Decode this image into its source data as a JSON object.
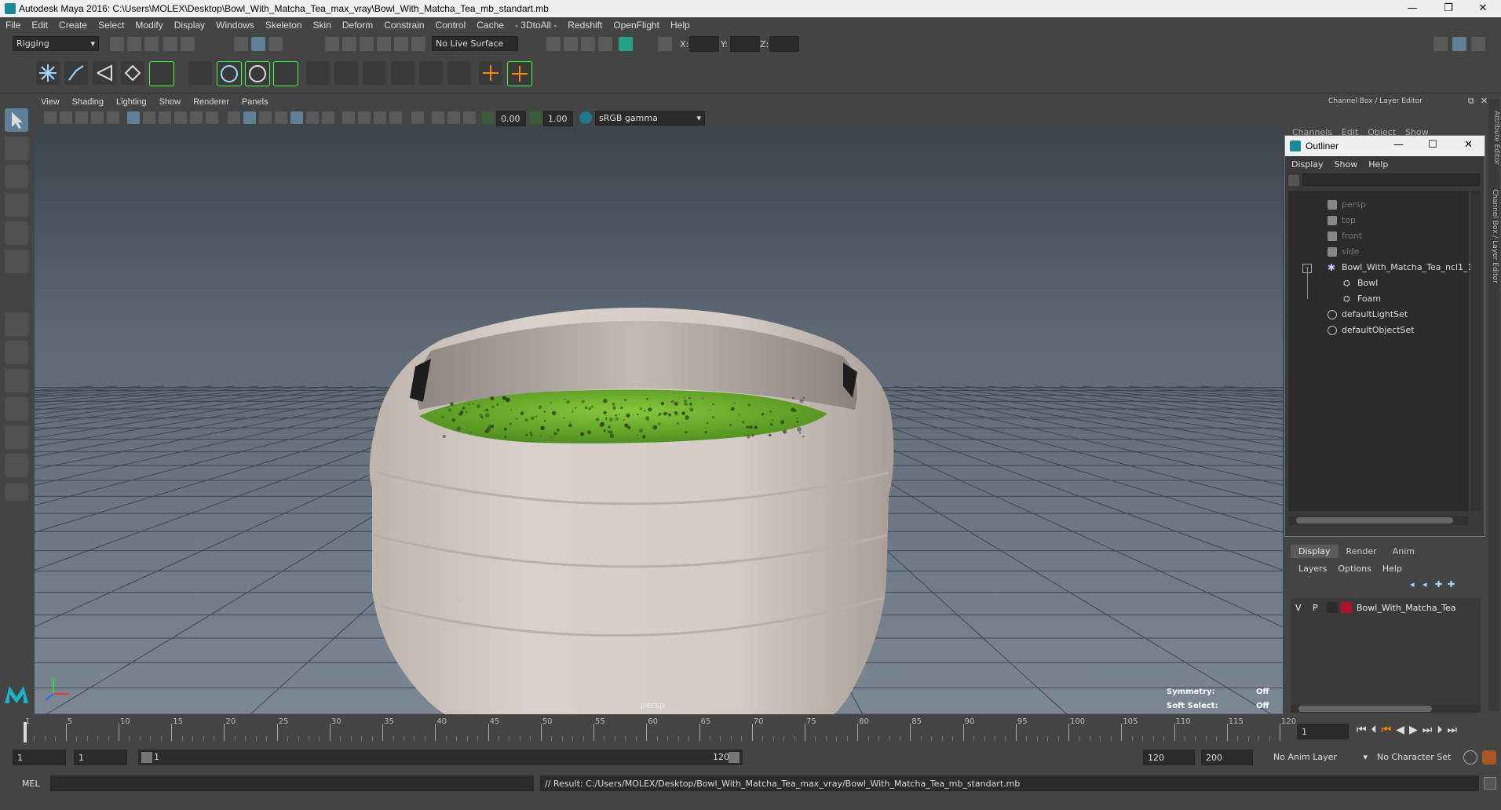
{
  "window": {
    "title": "Autodesk Maya 2016: C:\\Users\\MOLEX\\Desktop\\Bowl_With_Matcha_Tea_max_vray\\Bowl_With_Matcha_Tea_mb_standart.mb",
    "minimize": "—",
    "restore": "❐",
    "close": "✕"
  },
  "menubar": [
    "File",
    "Edit",
    "Create",
    "Select",
    "Modify",
    "Display",
    "Windows",
    "Skeleton",
    "Skin",
    "Deform",
    "Constrain",
    "Control",
    "Cache",
    "- 3DtoAll -",
    "Redshift",
    "OpenFlight",
    "Help"
  ],
  "statusline": {
    "menuset": "Rigging",
    "live_surface": "No Live Surface",
    "x_label": "X:",
    "y_label": "Y:",
    "z_label": "Z:"
  },
  "panel_menu": [
    "View",
    "Shading",
    "Lighting",
    "Show",
    "Renderer",
    "Panels"
  ],
  "panel_toolbar": {
    "exposure": "0.00",
    "gamma": "1.00",
    "colorspace": "sRGB gamma"
  },
  "viewport": {
    "camera": "persp",
    "symmetry_label": "Symmetry:",
    "symmetry_value": "Off",
    "soft_label": "Soft Select:",
    "soft_value": "Off",
    "colors": {
      "bowl": "#cfc7c0",
      "matcha": "#6bb22c"
    }
  },
  "channel_box": {
    "title": "Channel Box / Layer Editor",
    "menu": [
      "Channels",
      "Edit",
      "Object",
      "Show"
    ],
    "side_tab_1": "Attribute Editor",
    "side_tab_2": "Channel Box / Layer Editor"
  },
  "outliner": {
    "title": "Outliner",
    "menu": [
      "Display",
      "Show",
      "Help"
    ],
    "items": [
      {
        "label": "persp",
        "indent": 0,
        "dim": true,
        "icon": "camera-icon"
      },
      {
        "label": "top",
        "indent": 0,
        "dim": true,
        "icon": "camera-icon"
      },
      {
        "label": "front",
        "indent": 0,
        "dim": true,
        "icon": "camera-icon"
      },
      {
        "label": "side",
        "indent": 0,
        "dim": true,
        "icon": "camera-icon"
      },
      {
        "label": "Bowl_With_Matcha_Tea_ncl1_1",
        "indent": 0,
        "dim": false,
        "icon": "group-icon"
      },
      {
        "label": "Bowl",
        "indent": 1,
        "dim": false,
        "icon": "mesh-icon"
      },
      {
        "label": "Foam",
        "indent": 1,
        "dim": false,
        "icon": "mesh-icon"
      },
      {
        "label": "defaultLightSet",
        "indent": 0,
        "dim": false,
        "icon": "set-icon"
      },
      {
        "label": "defaultObjectSet",
        "indent": 0,
        "dim": false,
        "icon": "set-icon"
      }
    ]
  },
  "layer_editor": {
    "tabs": [
      "Display",
      "Render",
      "Anim"
    ],
    "menu": [
      "Layers",
      "Options",
      "Help"
    ],
    "layer": {
      "v": "V",
      "p": "P",
      "name": "Bowl_With_Matcha_Tea",
      "color": "#b0102a"
    }
  },
  "timeline": {
    "ticks": [
      "1",
      "5",
      "10",
      "15",
      "20",
      "25",
      "30",
      "35",
      "40",
      "45",
      "50",
      "55",
      "60",
      "65",
      "70",
      "75",
      "80",
      "85",
      "90",
      "95",
      "100",
      "105",
      "110",
      "115",
      "120"
    ],
    "current_frame": "1"
  },
  "range": {
    "start": "1",
    "playback_start": "1",
    "range_start_label": "1",
    "range_end_label": "120",
    "playback_end": "120",
    "end": "200",
    "anim_layer": "No Anim Layer",
    "character_set": "No Character Set"
  },
  "command": {
    "lang": "MEL",
    "result": "// Result: C:/Users/MOLEX/Desktop/Bowl_With_Matcha_Tea_max_vray/Bowl_With_Matcha_Tea_mb_standart.mb"
  }
}
